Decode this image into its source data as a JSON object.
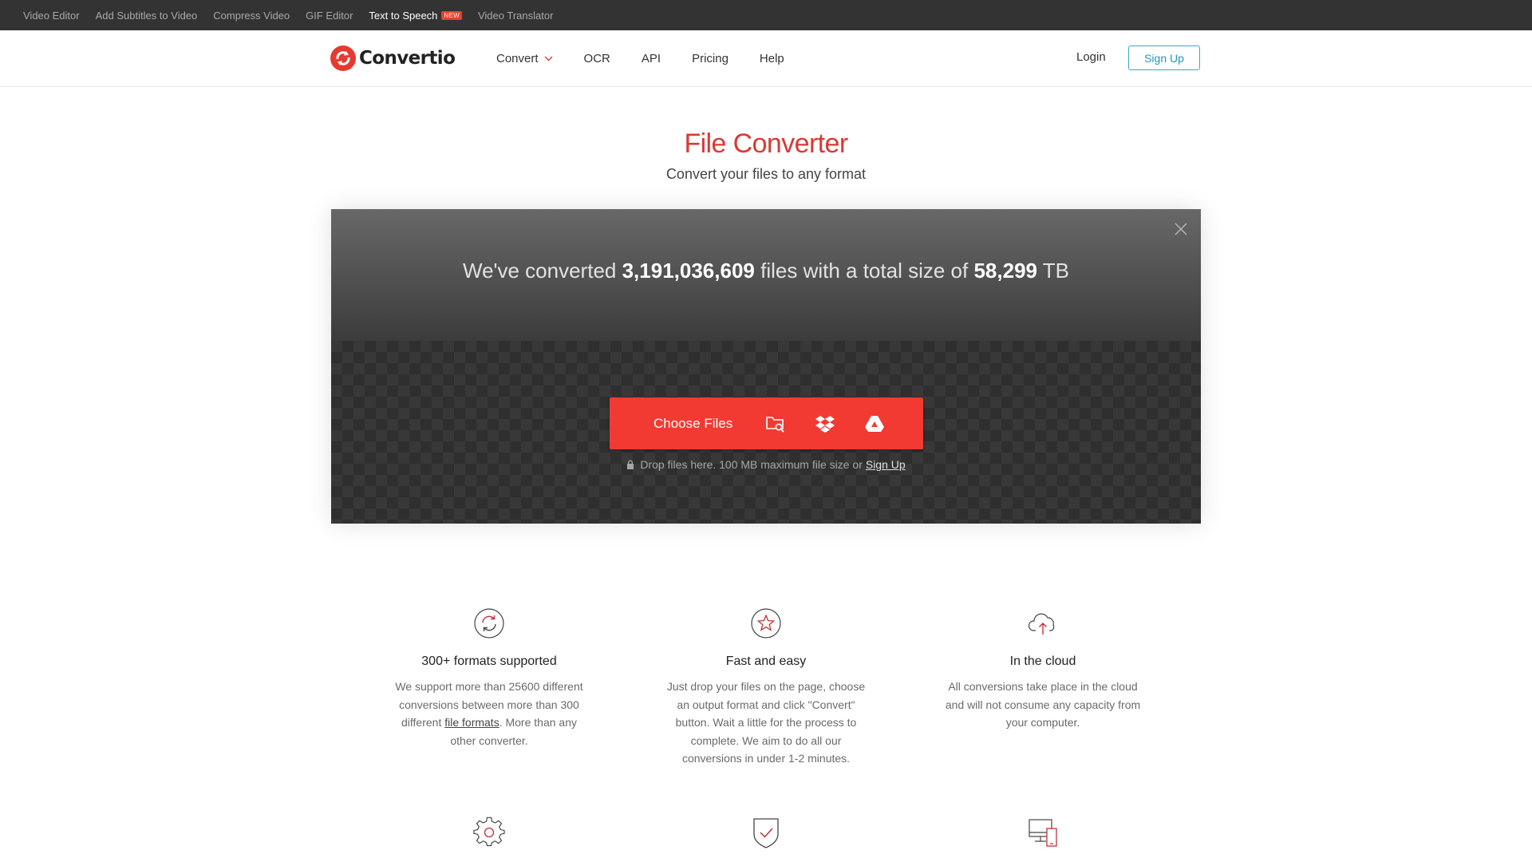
{
  "topbar": {
    "links": [
      {
        "label": "Video Editor"
      },
      {
        "label": "Add Subtitles to Video"
      },
      {
        "label": "Compress Video"
      },
      {
        "label": "GIF Editor"
      },
      {
        "label": "Text to Speech",
        "badge": "NEW"
      },
      {
        "label": "Video Translator"
      }
    ]
  },
  "nav": {
    "brand": "Convertio",
    "links": [
      "Convert",
      "OCR",
      "API",
      "Pricing",
      "Help"
    ],
    "login": "Login",
    "signup": "Sign Up"
  },
  "hero": {
    "title": "File Converter",
    "subtitle": "Convert your files to any format"
  },
  "stats": {
    "prefix": "We've converted",
    "files": "3,191,036,609",
    "middle": "files with a total size of",
    "size": "58,299",
    "unit": "TB"
  },
  "upload": {
    "choose_label": "Choose Files",
    "note": "Drop files here. 100 MB maximum file size or",
    "note_link": "Sign Up"
  },
  "features": [
    {
      "title": "300+ formats supported",
      "text_before": "We support more than 25600 different conversions between more than 300 different",
      "link": "file formats",
      "text_after": ". More than any other converter."
    },
    {
      "title": "Fast and easy",
      "text": "Just drop your files on the page, choose an output format and click \"Convert\" button. Wait a little for the process to complete. We aim to do all our conversions in under 1-2 minutes."
    },
    {
      "title": "In the cloud",
      "text": "All conversions take place in the cloud and will not consume any capacity from your computer."
    }
  ],
  "icons": {
    "brand_color": "#e8392f",
    "feature_color": "#c0333a",
    "row1": [
      "refresh-icon",
      "star-icon",
      "cloud-upload-icon"
    ],
    "row2": [
      "gear-icon",
      "shield-check-icon",
      "devices-icon"
    ]
  }
}
